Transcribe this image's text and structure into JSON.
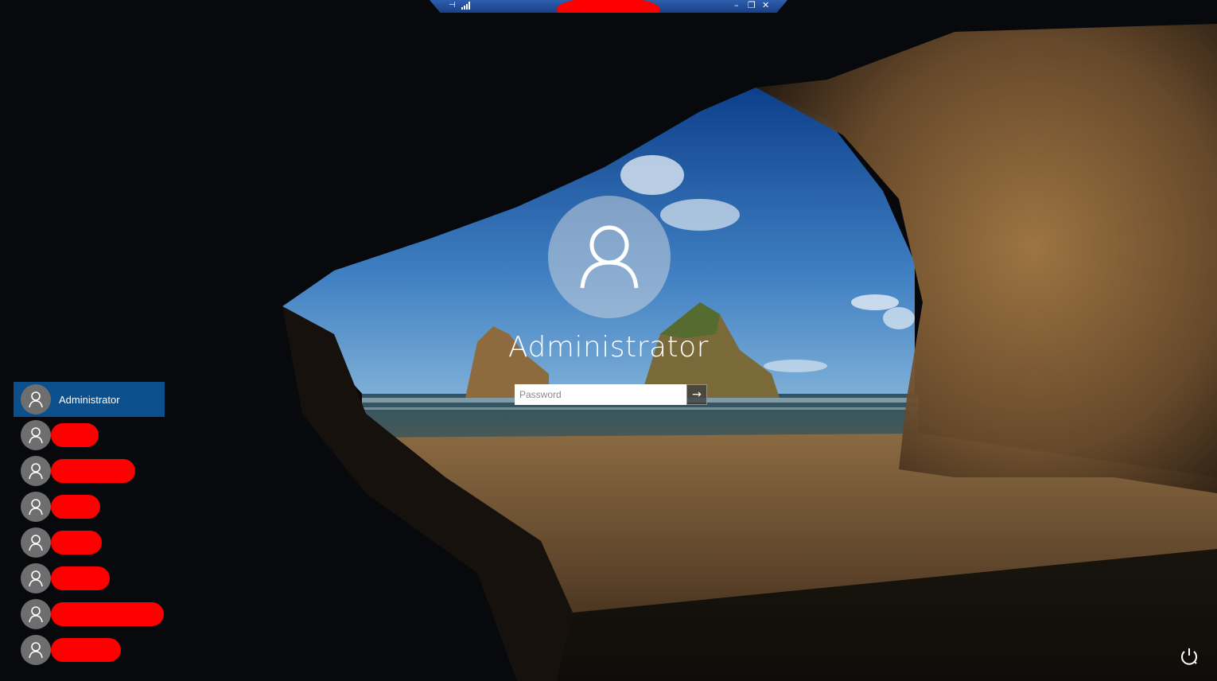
{
  "rdp_bar": {
    "pin_glyph": "⊣",
    "controls": {
      "minimize": "–",
      "restore": "❐",
      "close": "✕"
    }
  },
  "login": {
    "username": "Administrator",
    "password_placeholder": "Password",
    "submit_glyph": "→"
  },
  "users": [
    {
      "name": "Administrator",
      "selected": true,
      "redacted": false
    },
    {
      "name": "",
      "selected": false,
      "redacted": true
    },
    {
      "name": "",
      "selected": false,
      "redacted": true
    },
    {
      "name": "",
      "selected": false,
      "redacted": true
    },
    {
      "name": "",
      "selected": false,
      "redacted": true
    },
    {
      "name": "",
      "selected": false,
      "redacted": true
    },
    {
      "name": "",
      "selected": false,
      "redacted": true
    },
    {
      "name": "",
      "selected": false,
      "redacted": true
    }
  ],
  "icons": {
    "user": "user-icon",
    "power": "power-icon",
    "signal": "signal-icon",
    "submit": "arrow-right-icon"
  },
  "colors": {
    "selection": "#0b4f8c",
    "redaction": "#ff0000",
    "rdp_bar": "#1a3f85"
  }
}
